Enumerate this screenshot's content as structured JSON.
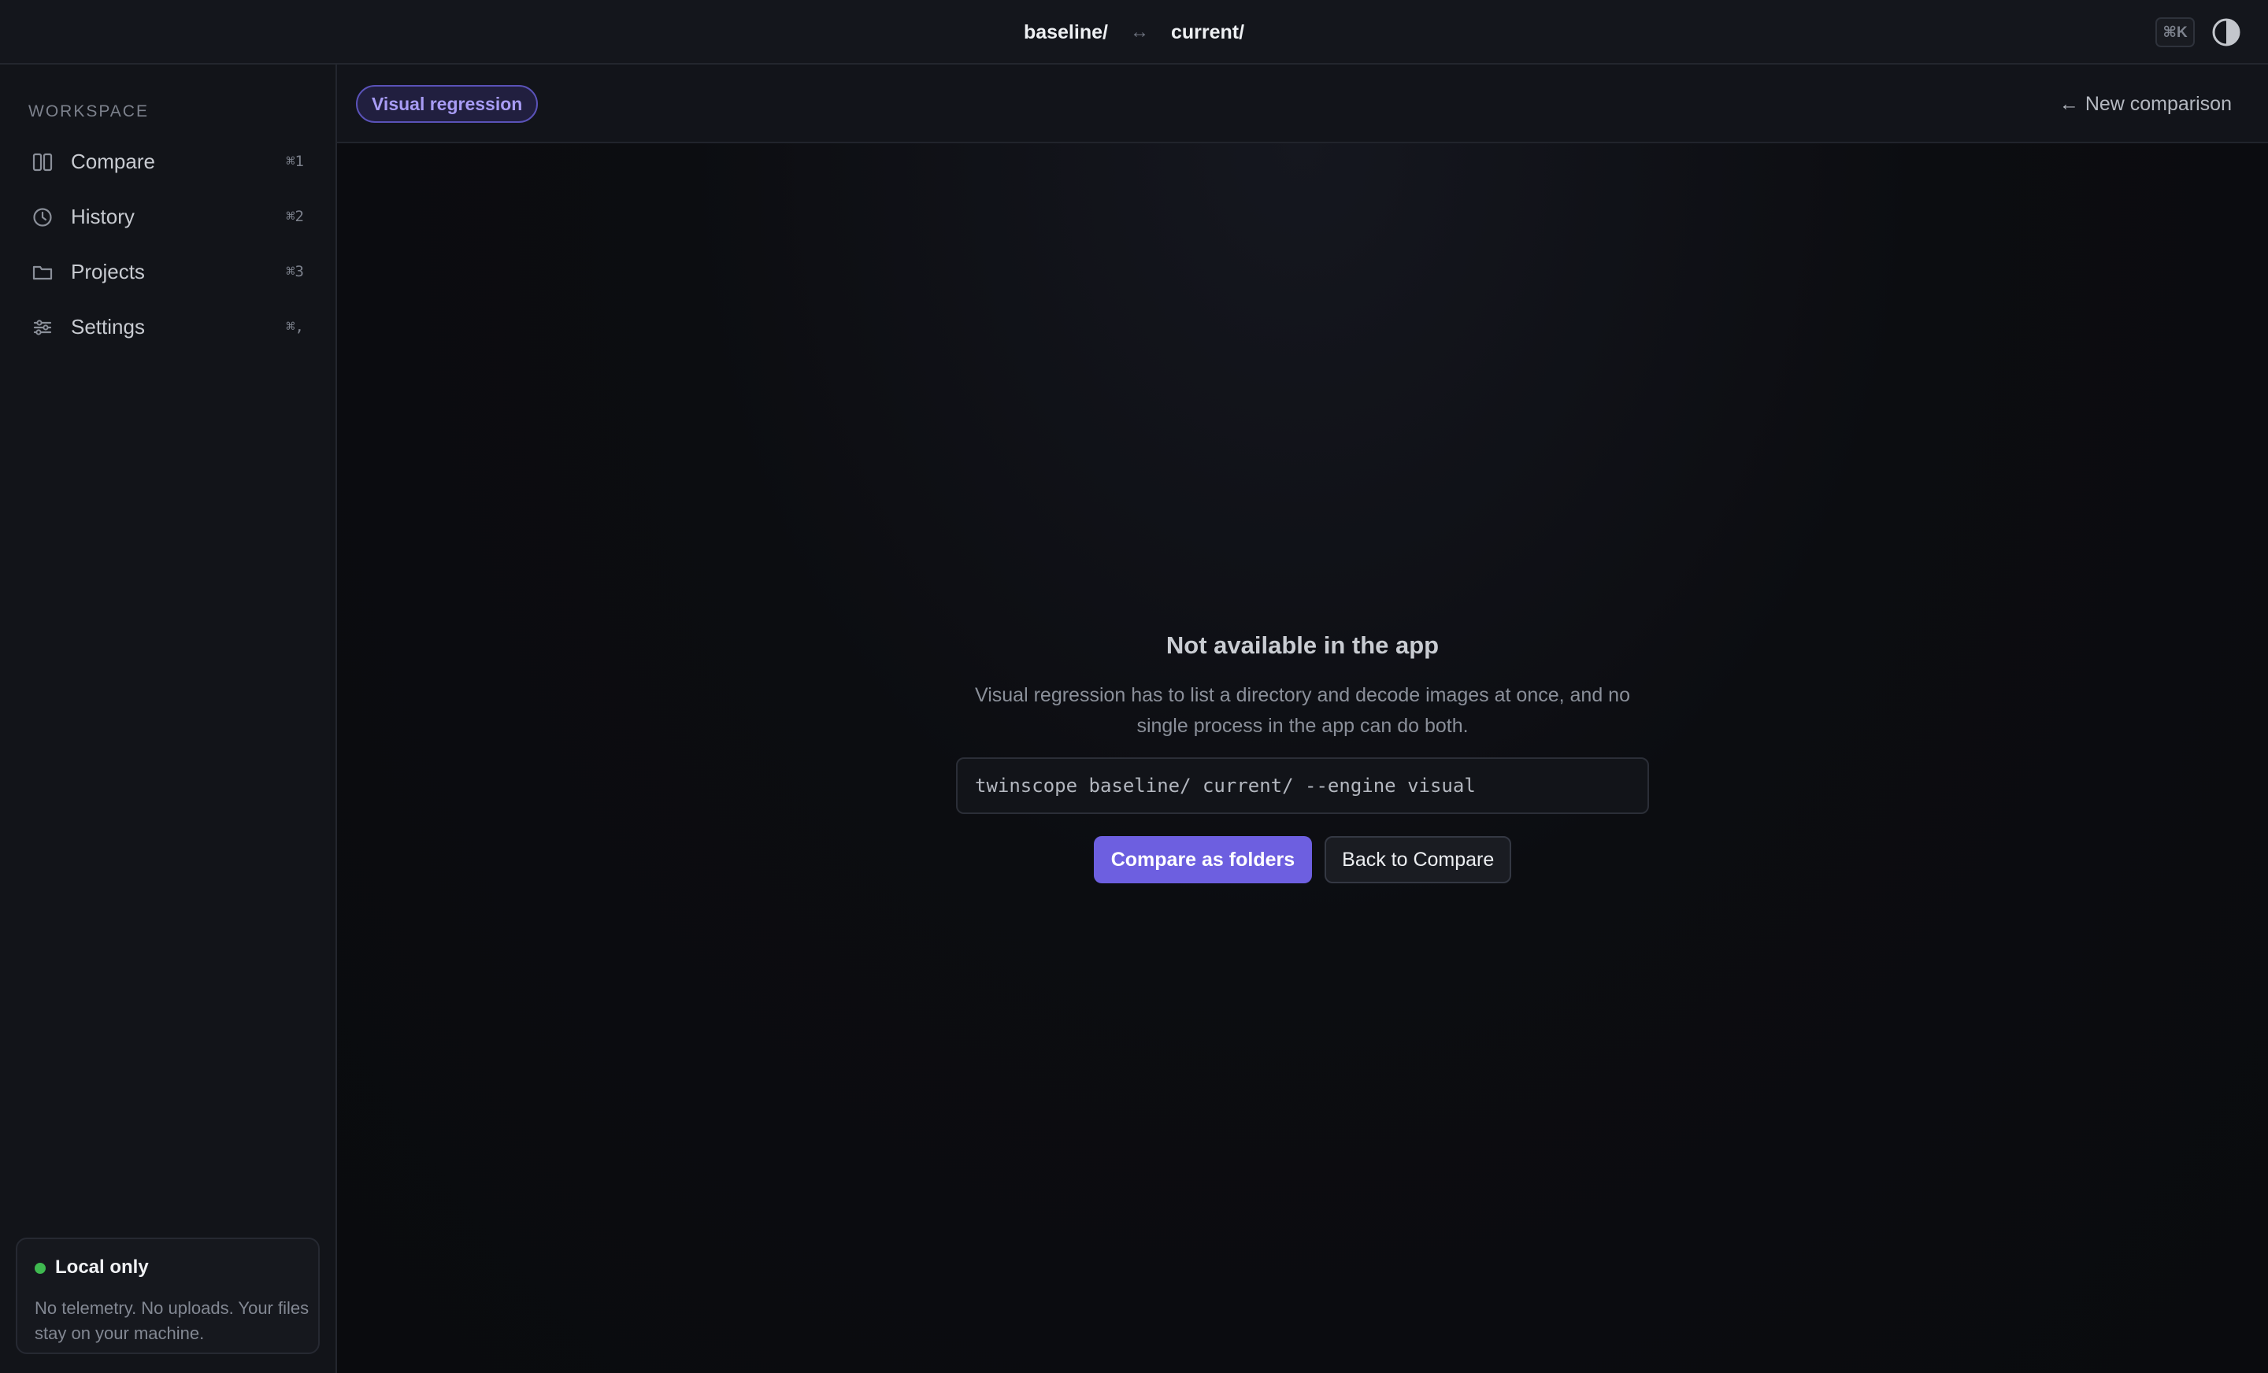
{
  "titlebar": {
    "left_path": "baseline/",
    "separator": "↔",
    "right_path": "current/",
    "command_shortcut": "⌘K",
    "theme_toggle_icon": "contrast-icon"
  },
  "sidebar": {
    "section_label": "WORKSPACE",
    "items": [
      {
        "label": "Compare",
        "shortcut": "⌘1",
        "icon": "columns-icon"
      },
      {
        "label": "History",
        "shortcut": "⌘2",
        "icon": "clock-icon"
      },
      {
        "label": "Projects",
        "shortcut": "⌘3",
        "icon": "folder-icon"
      },
      {
        "label": "Settings",
        "shortcut": "⌘,",
        "icon": "sliders-icon"
      }
    ],
    "status_card": {
      "title": "Local only",
      "description": "No telemetry. No uploads. Your files stay on your machine.",
      "status_color": "#3fb950"
    }
  },
  "header": {
    "mode_badge": "Visual regression",
    "new_comparison_arrow": "←",
    "new_comparison_label": "New comparison"
  },
  "empty_state": {
    "title": "Not available in the app",
    "description": "Visual regression has to list a directory and decode images at once, and no single process in the app can do both.",
    "command": "twinscope baseline/ current/ --engine visual",
    "primary_action": "Compare as folders",
    "secondary_action": "Back to Compare"
  },
  "colors": {
    "accent": "#6d5fe0",
    "badge_text": "#a89cf5",
    "background": "#0a0b0e"
  }
}
